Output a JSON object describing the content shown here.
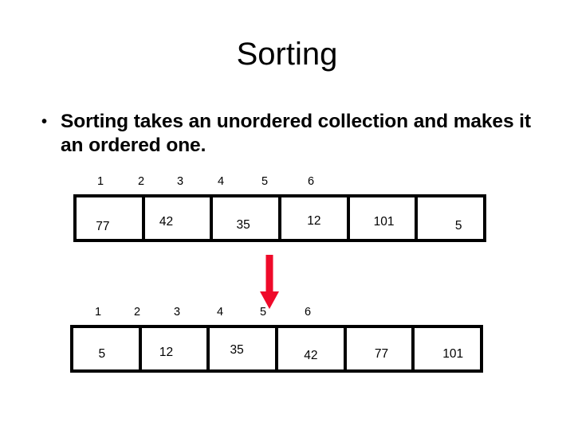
{
  "slide": {
    "title": "Sorting",
    "bullet": {
      "marker": "•",
      "text": "Sorting takes an unordered collection and makes it an ordered one."
    }
  },
  "arrays": {
    "unsorted": {
      "name": "unsorted-array",
      "indices": [
        "1",
        "2",
        "3",
        "4",
        "5",
        "6"
      ],
      "values": [
        "77",
        "42",
        "35",
        "12",
        "101",
        "5"
      ]
    },
    "sorted": {
      "name": "sorted-array",
      "indices": [
        "1",
        "2",
        "3",
        "4",
        "5",
        "6"
      ],
      "values": [
        "5",
        "12",
        "35",
        "42",
        "77",
        "101"
      ]
    }
  },
  "arrow": {
    "direction": "down",
    "color": "#ef0a2a"
  },
  "colors": {
    "background": "#ffffff",
    "text": "#000000",
    "border": "#000000",
    "accent": "#ef0a2a"
  }
}
